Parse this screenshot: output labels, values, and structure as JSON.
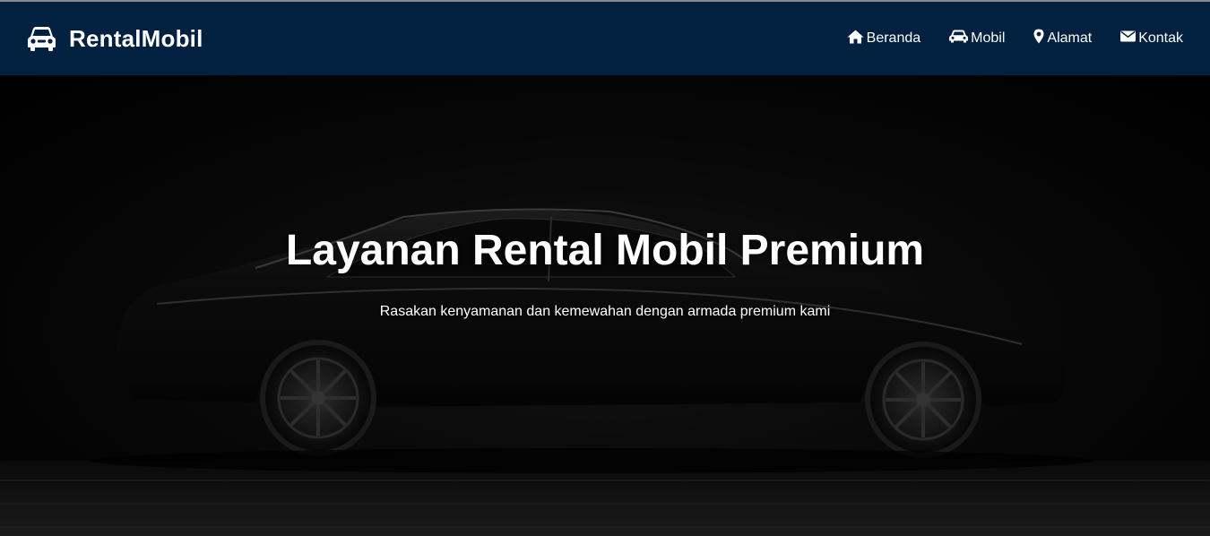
{
  "navbar": {
    "brand": {
      "icon": "car-icon",
      "label": "RentalMobil"
    },
    "links": [
      {
        "icon": "home-icon",
        "label": "Beranda"
      },
      {
        "icon": "car-icon",
        "label": "Mobil"
      },
      {
        "icon": "map-marker-icon",
        "label": "Alamat"
      },
      {
        "icon": "envelope-icon",
        "label": "Kontak"
      }
    ],
    "background_color": "#02203f"
  },
  "hero": {
    "title": "Layanan Rental Mobil Premium",
    "subtitle": "Rasakan kenyamanan dan kemewahan dengan armada premium kami",
    "background_image": "dark-luxury-sedan-photo"
  }
}
